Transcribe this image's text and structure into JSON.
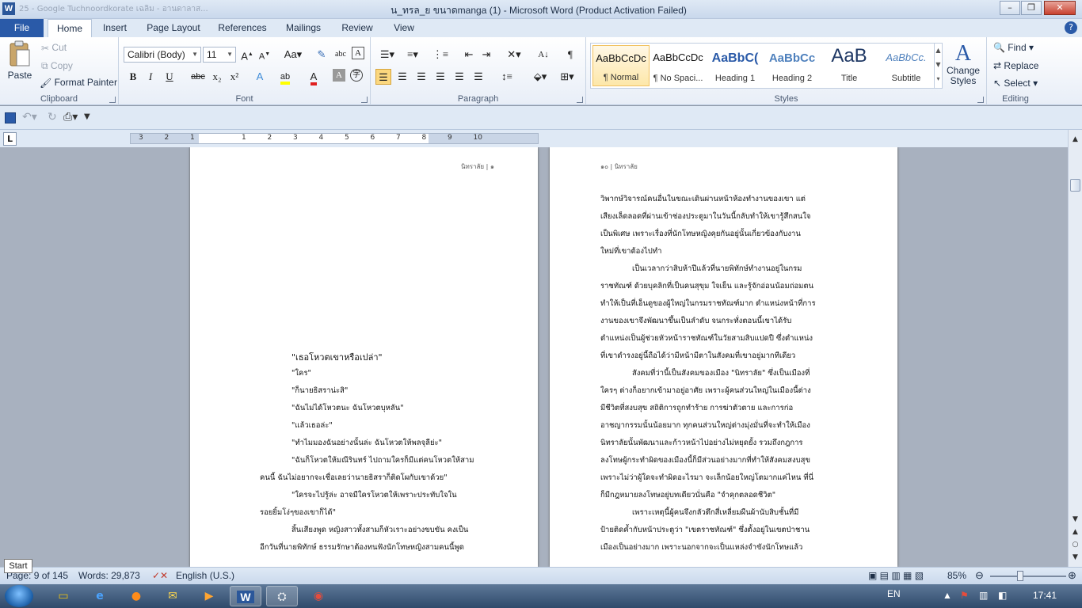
{
  "window": {
    "title": "น_ทรล_ย ขนาดmanga (1) - Microsoft Word (Product Activation Failed)",
    "app_icon_letter": "W",
    "faded_tabs_text": "25 - Google Tuchnoordkorate     เฉลิม - อานดาลาส..."
  },
  "window_controls": {
    "minimize": "–",
    "maximize": "❐",
    "close": "✕"
  },
  "tabs": {
    "file": "File",
    "items": [
      "Home",
      "Insert",
      "Page Layout",
      "References",
      "Mailings",
      "Review",
      "View"
    ],
    "active": "Home"
  },
  "ribbon": {
    "clipboard": {
      "paste": "Paste",
      "cut": "Cut",
      "copy": "Copy",
      "format_painter": "Format Painter",
      "label": "Clipboard"
    },
    "font": {
      "font_name": "Calibri (Body)",
      "font_size": "11",
      "label": "Font",
      "bold": "B",
      "italic": "I",
      "underline": "U",
      "strike": "abc",
      "subscript": "x₂",
      "superscript": "x²",
      "text_color": "#e02020",
      "highlight_color": "#ffff00"
    },
    "paragraph": {
      "label": "Paragraph"
    },
    "styles": {
      "label": "Styles",
      "items": [
        {
          "sample": "AaBbCcDc",
          "name": "¶ Normal"
        },
        {
          "sample": "AaBbCcDc",
          "name": "¶ No Spaci..."
        },
        {
          "sample": "AaBbC(",
          "name": "Heading 1"
        },
        {
          "sample": "AaBbCc",
          "name": "Heading 2"
        },
        {
          "sample": "AaB",
          "name": "Title"
        },
        {
          "sample": "AaBbCc.",
          "name": "Subtitle"
        }
      ],
      "change_styles": "Change Styles"
    },
    "editing": {
      "label": "Editing",
      "find": "Find",
      "replace": "Replace",
      "select": "Select"
    }
  },
  "ruler": {
    "numbers": [
      "3",
      "2",
      "1",
      "",
      "1",
      "2",
      "3",
      "4",
      "5",
      "6",
      "7",
      "8",
      "9",
      "10"
    ],
    "tab_selector": "L"
  },
  "document": {
    "left_page": {
      "header": "นิทราลัย | ๑",
      "lines": [
        {
          "text": "\"เธอโหวตเขาหรือเปล่า\"",
          "style": "title"
        },
        {
          "text": "\"ใคร\""
        },
        {
          "text": "\"ก็นายธิสราน่ะสิ\""
        },
        {
          "text": "\"ฉันไม่ได้โหวตนะ ฉันโหวตบุหลัน\""
        },
        {
          "text": "\"แล้วเธอล่ะ\""
        },
        {
          "text": "\"ทำไมมองฉันอย่างนั้นล่ะ ฉันโหวตให้พลจุลีย่ะ\""
        },
        {
          "text": "\"ฉันก็โหวตให้มณีรินทร์ ไปถามใครก็มีแต่คนโหวตให้สาม"
        },
        {
          "text": "คนนี้ ฉันไม่อยากจะเชื่อเลยว่านายธิสราก็ติดโผกับเขาด้วย\""
        },
        {
          "text": "\"ใครจะไปรู้ล่ะ อาจมีใครโหวตให้เพราะประทับใจใน"
        },
        {
          "text": "รอยยิ้มโง่ๆของเขาก็ได้\""
        },
        {
          "text": "สิ้นเสียงพูด หญิงสาวทั้งสามก็หัวเราะอย่างขบขัน คงเป็น"
        },
        {
          "text": "อีกวันที่นายพิทักษ์ ธรรมรักษาต้องทนฟังนักโทษหญิงสามคนนี้พูด"
        }
      ]
    },
    "right_page": {
      "header": "๑๐ | นิทราลัย",
      "lines": [
        {
          "text": "วิพากษ์วิจารณ์คนอื่นในขณะเดินผ่านหน้าห้องทำงานของเขา แต่"
        },
        {
          "text": "เสียงเล็ดลอดที่ผ่านเข้าช่องประตูมาในวันนี้กลับทำให้เขารู้สึกสนใจ"
        },
        {
          "text": "เป็นพิเศษ เพราะเรื่องที่นักโทษหญิงคุยกันอยู่นั้นเกี่ยวข้องกับงาน"
        },
        {
          "text": "ใหม่ที่เขาต้องไปทำ"
        },
        {
          "text": "เป็นเวลากว่าสิบห้าปีแล้วที่นายพิทักษ์ทำงานอยู่ในกรม"
        },
        {
          "text": "ราชทัณฑ์ ด้วยบุคลิกที่เป็นคนสุขุม ใจเย็น และรู้จักอ่อนน้อมถ่อมตน"
        },
        {
          "text": "ทำให้เป็นที่เอ็นดูของผู้ใหญ่ในกรมราชทัณฑ์มาก ตำแหน่งหน้าที่การ"
        },
        {
          "text": "งานของเขาจึงพัฒนาขึ้นเป็นลำดับ จนกระทั่งตอนนี้เขาได้รับ"
        },
        {
          "text": "ตำแหน่งเป็นผู้ช่วยหัวหน้าราชทัณฑ์ในวัยสามสิบแปดปี ซึ่งตำแหน่ง"
        },
        {
          "text": "ที่เขาดำรงอยู่นี้ถือได้ว่ามีหน้ามีตาในสังคมที่เขาอยู่มากทีเดียว"
        },
        {
          "text": "สังคมที่ว่านี้เป็นสังคมของเมือง \"นิทราลัย\" ซึ่งเป็นเมืองที่"
        },
        {
          "text": "ใครๆ ต่างก็อยากเข้ามาอยู่อาศัย เพราะผู้คนส่วนใหญ่ในเมืองนี้ต่าง"
        },
        {
          "text": "มีชีวิตที่สงบสุข สถิติการถูกทำร้าย การฆ่าตัวตาย และการก่อ"
        },
        {
          "text": "อาชญากรรมนั้นน้อยมาก ทุกคนส่วนใหญ่ต่างมุ่งมั่นที่จะทำให้เมือง"
        },
        {
          "text": "นิทราลัยนั้นพัฒนาและก้าวหน้าไปอย่างไม่หยุดยั้ง รวมถึงกฎการ"
        },
        {
          "text": "ลงโทษผู้กระทำผิดของเมืองนี้ก็มีส่วนอย่างมากที่ทำให้สังคมสงบสุข"
        },
        {
          "text": "เพราะไม่ว่าผู้ใดจะทำผิดอะไรมา จะเล็กน้อยใหญ่โตมากแค่ไหน ที่นี่"
        },
        {
          "text": "ก็มีกฎหมายลงโทษอยู่บทเดียวนั่นคือ \"จำคุกตลอดชีวิต\""
        },
        {
          "text": "เพราะเหตุนี้ผู้คนจึงกลัวตึกสี่เหลี่ยมผืนผ้านับสิบชั้นที่มี"
        },
        {
          "text": "ป้ายติดค้ำกับหน้าประตูว่า \"เขตราชทัณฑ์\" ซึ่งตั้งอยู่ในเขตป่าชาน"
        },
        {
          "text": "เมืองเป็นอย่างมาก เพราะนอกจากจะเป็นแหล่งจำขังนักโทษแล้ว"
        }
      ]
    }
  },
  "status_bar": {
    "page": "Page: 9 of 145",
    "words": "Words: 29,873",
    "language": "English (U.S.)",
    "zoom": "85%"
  },
  "tooltip": {
    "start": "Start"
  },
  "taskbar": {
    "lang": "EN",
    "time": "17:41"
  }
}
